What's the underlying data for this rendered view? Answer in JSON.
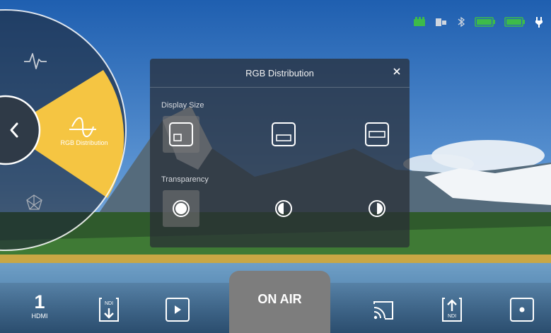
{
  "status_bar": {
    "icons": [
      "signal-icon",
      "sd-card-icon",
      "bluetooth-icon",
      "battery-1-icon",
      "battery-2-icon",
      "power-plug-icon"
    ],
    "accent_green": "#3dbb4a"
  },
  "menu_wheel": {
    "items": [
      {
        "label": "",
        "icon": "waveform-icon"
      },
      {
        "label": "RGB Distribution",
        "icon": "rgb-curve-icon",
        "active": true
      },
      {
        "label": "",
        "icon": "cube-icon"
      }
    ],
    "back_icon": "chevron-left-icon",
    "active_color": "#f5c542"
  },
  "panel": {
    "title": "RGB Distribution",
    "close_icon": "close-icon",
    "display_size": {
      "label": "Display Size",
      "options": [
        "small",
        "medium",
        "large"
      ],
      "selected": 0
    },
    "transparency": {
      "label": "Transparency",
      "options": [
        "opaque",
        "half",
        "clear"
      ],
      "selected": 0
    }
  },
  "bottom_bar": {
    "input_number": "1",
    "input_label": "HDMI",
    "ndi_in_label": "NDI",
    "ndi_out_label": "NDI",
    "on_air_label": "ON AIR"
  }
}
